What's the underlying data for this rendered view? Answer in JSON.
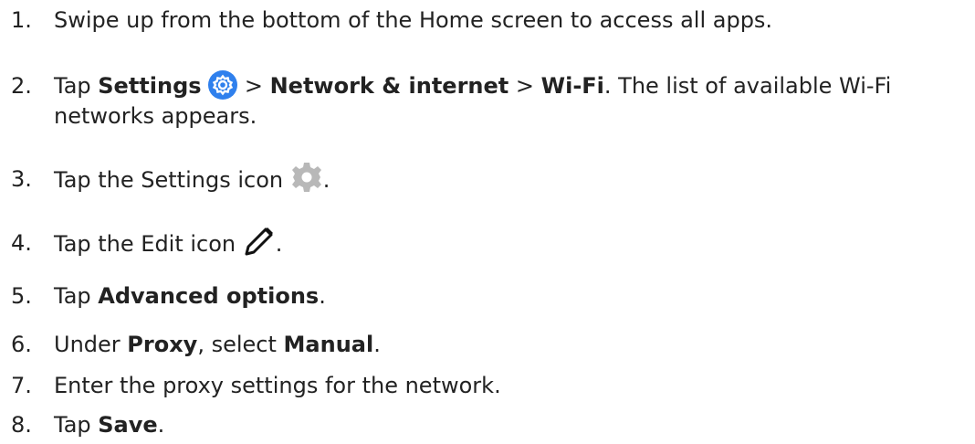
{
  "steps": [
    {
      "number": "1.",
      "parts": [
        "Swipe up from the bottom of the Home screen to access all apps."
      ]
    },
    {
      "number": "2.",
      "parts": [
        "Tap ",
        "Settings",
        " > ",
        "Network & internet",
        " > ",
        "Wi-Fi",
        ". The list of available Wi-Fi",
        "networks appears."
      ],
      "icon": "settings-app-icon"
    },
    {
      "number": "3.",
      "parts": [
        "Tap the Settings icon ",
        "."
      ],
      "icon": "gear-icon"
    },
    {
      "number": "4.",
      "parts": [
        "Tap the Edit icon ",
        "."
      ],
      "icon": "pencil-icon"
    },
    {
      "number": "5.",
      "parts": [
        "Tap ",
        "Advanced options",
        "."
      ]
    },
    {
      "number": "6.",
      "parts": [
        "Under ",
        "Proxy",
        ", select ",
        "Manual",
        "."
      ]
    },
    {
      "number": "7.",
      "parts": [
        "Enter the proxy settings for the network."
      ]
    },
    {
      "number": "8.",
      "parts": [
        "Tap ",
        "Save",
        "."
      ]
    }
  ],
  "colors": {
    "settings_app_icon": "#2f80ed",
    "gear_icon": "#b8b8b8",
    "text": "#222222"
  }
}
